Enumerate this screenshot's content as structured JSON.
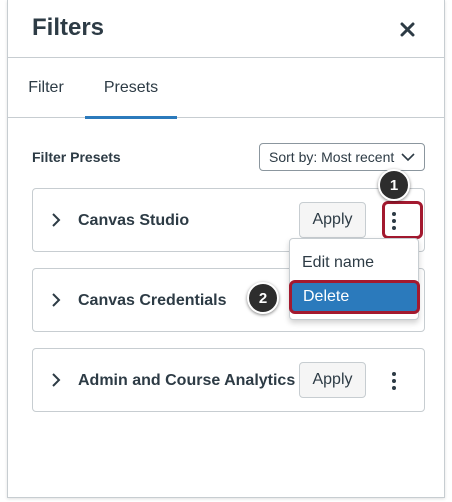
{
  "header": {
    "title": "Filters"
  },
  "tabs": [
    {
      "label": "Filter",
      "active": false
    },
    {
      "label": "Presets",
      "active": true
    }
  ],
  "section": {
    "title": "Filter Presets"
  },
  "sort": {
    "label": "Sort by: Most recent"
  },
  "presets": [
    {
      "name": "Canvas Studio",
      "apply_label": "Apply"
    },
    {
      "name": "Canvas Credentials",
      "apply_label": "Apply"
    },
    {
      "name": "Admin and Course Analytics",
      "apply_label": "Apply"
    }
  ],
  "menu": {
    "items": [
      {
        "label": "Edit name"
      },
      {
        "label": "Delete",
        "highlighted": true
      }
    ]
  },
  "steps": [
    {
      "label": "1"
    },
    {
      "label": "2"
    }
  ],
  "colors": {
    "accent": "#2b7abc",
    "highlight": "#a3192f",
    "text": "#2d3b45",
    "border": "#c7cdd1"
  },
  "icons": {
    "close": "close-icon",
    "expand": "chevron-right-icon",
    "more": "more-vertical-icon",
    "dropdown": "chevron-down-icon"
  }
}
